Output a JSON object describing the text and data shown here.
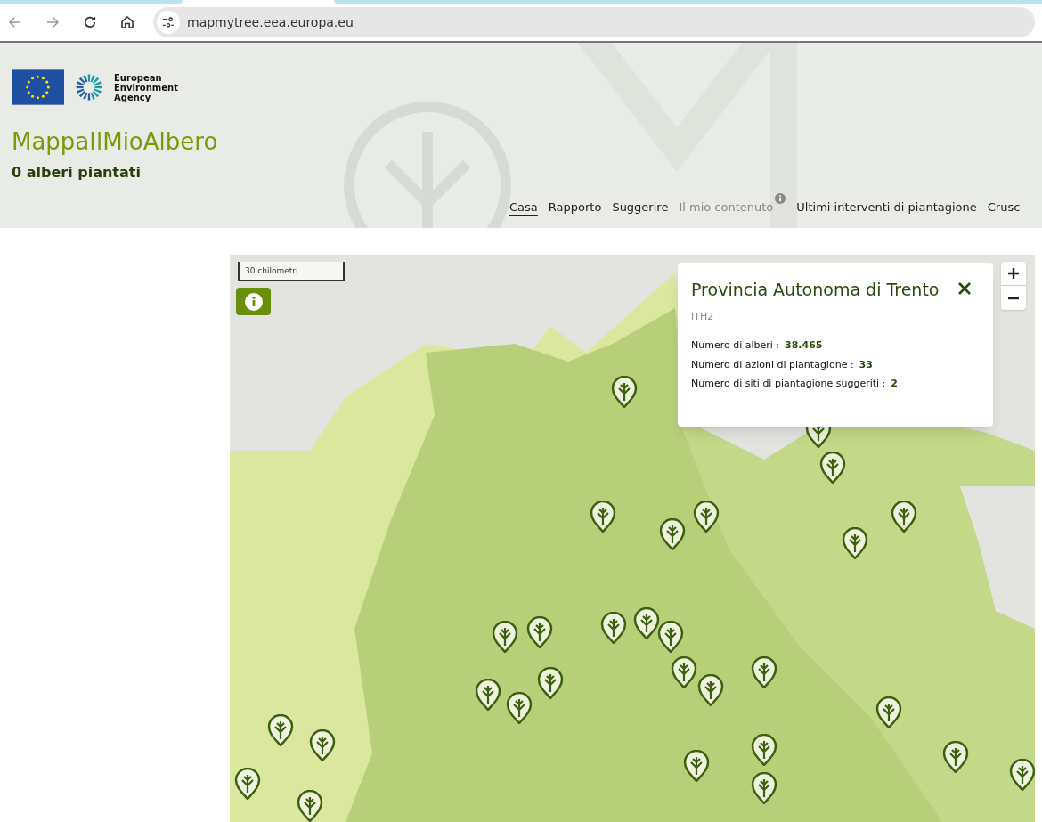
{
  "browser": {
    "url": "mapmytree.eea.europa.eu"
  },
  "header": {
    "agency": "European\nEnvironment\nAgency",
    "title": "MappaIlMioAlbero",
    "subtitle": "0 alberi piantati"
  },
  "nav": [
    {
      "label": "Casa",
      "selected": true,
      "disabled": false,
      "info": false
    },
    {
      "label": "Rapporto",
      "selected": false,
      "disabled": false,
      "info": false
    },
    {
      "label": "Suggerire",
      "selected": false,
      "disabled": false,
      "info": false
    },
    {
      "label": "Il mio contenuto",
      "selected": false,
      "disabled": true,
      "info": true
    },
    {
      "label": "Ultimi interventi di piantagione",
      "selected": false,
      "disabled": false,
      "info": false
    },
    {
      "label": "Crusc",
      "selected": false,
      "disabled": false,
      "info": false
    }
  ],
  "map": {
    "scale": "30 chilometri",
    "popup": {
      "title": "Provincia Autonoma di Trento",
      "code": "ITH2",
      "stats": [
        {
          "label": "Numero di alberi :",
          "value": "38.465"
        },
        {
          "label": "Numero di azioni di piantagione :",
          "value": "33"
        },
        {
          "label": "Numero di siti di piantagione suggeriti :",
          "value": "2"
        }
      ]
    }
  }
}
